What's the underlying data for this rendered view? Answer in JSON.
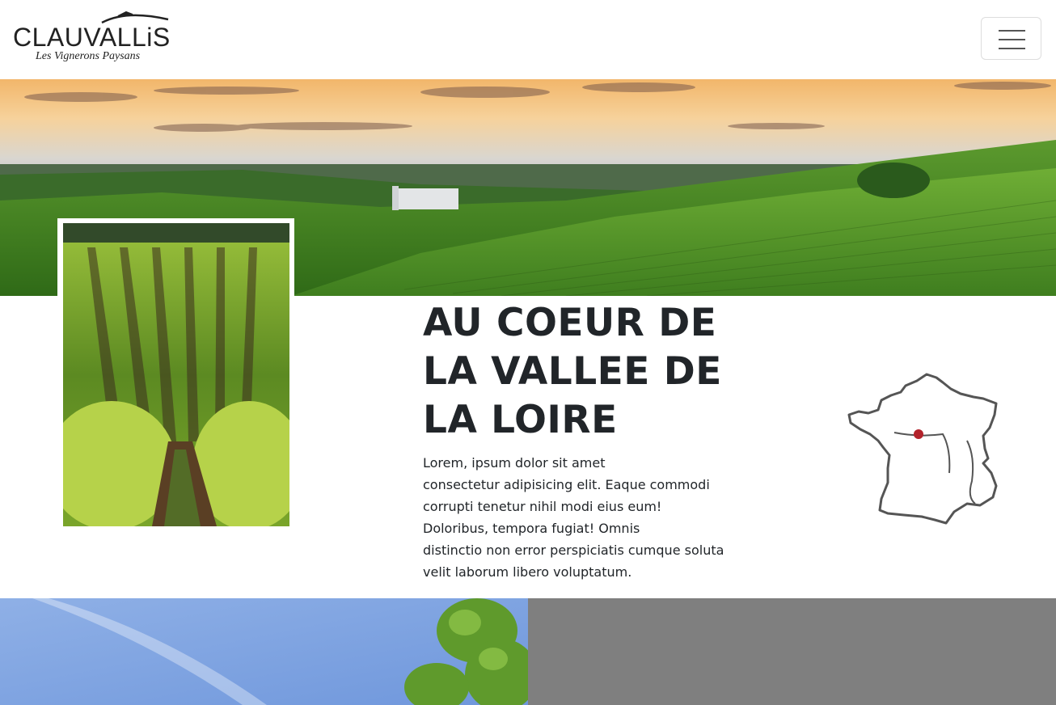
{
  "brand": {
    "name": "CLAUVALLiS",
    "tagline": "Les Vignerons Paysans"
  },
  "nav": {
    "toggle_icon": "hamburger-menu-icon"
  },
  "section": {
    "title_lines": [
      "AU COEUR DE",
      "LA VALLEE DE",
      "LA LOIRE"
    ],
    "body_lines": [
      "Lorem, ipsum dolor sit amet",
      "consectetur adipisicing elit. Eaque commodi",
      "corrupti tenetur nihil modi eius eum!",
      "Doloribus, tempora fugiat! Omnis",
      "distinctio non error perspiciatis cumque soluta",
      "velit laborum libero voluptatum."
    ]
  },
  "map": {
    "icon": "france-map-icon",
    "marker_color": "#b3232b"
  },
  "colors": {
    "text": "#212529",
    "panel_gray": "#7f7f7f"
  }
}
